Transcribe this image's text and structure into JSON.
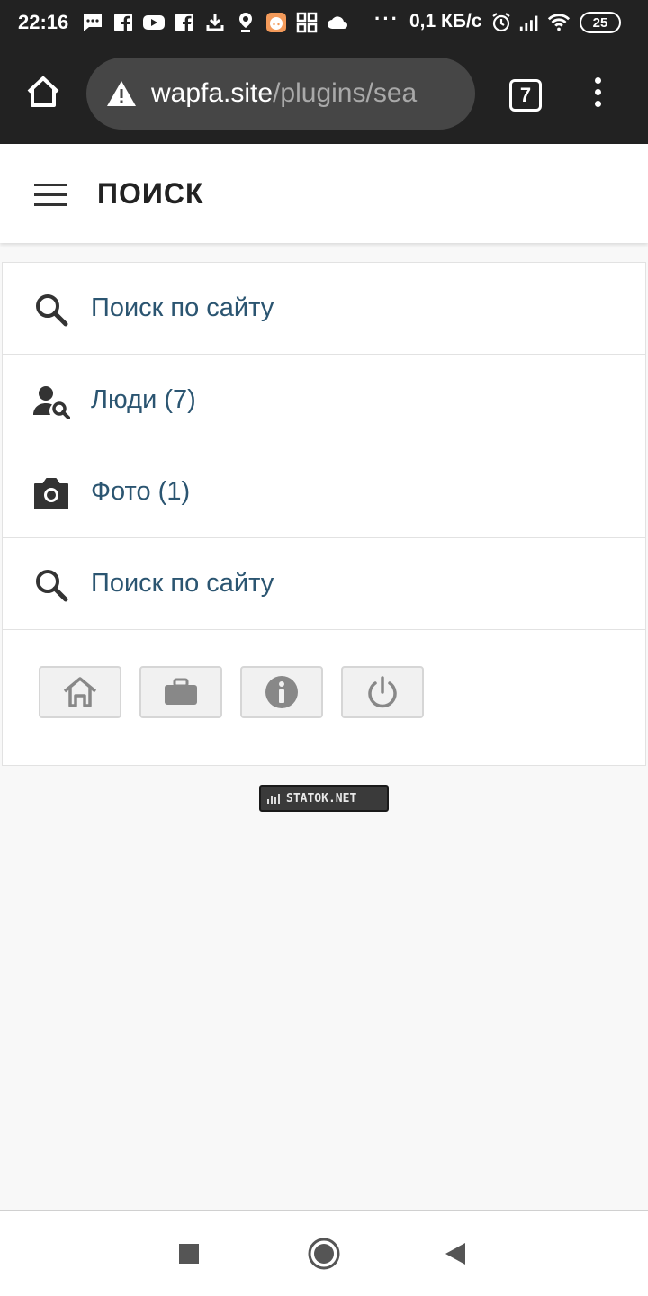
{
  "status_bar": {
    "time": "22:16",
    "dots": "···",
    "speed": "0,1 КБ/с",
    "battery": "25"
  },
  "browser": {
    "url_domain": "wapfa.site",
    "url_path": "/plugins/sea",
    "tab_count": "7"
  },
  "header": {
    "title": "ПОИСК"
  },
  "menu": {
    "items": [
      {
        "label": "Поиск по сайту",
        "icon": "search-icon"
      },
      {
        "label": "Люди (7)",
        "icon": "person-search-icon"
      },
      {
        "label": "Фото (1)",
        "icon": "camera-icon"
      },
      {
        "label": "Поиск по сайту",
        "icon": "search-icon"
      }
    ]
  },
  "toolbar": {
    "buttons": [
      "home-icon",
      "briefcase-icon",
      "info-icon",
      "power-icon"
    ]
  },
  "counter": {
    "label": "STATOK.NET"
  },
  "colors": {
    "link": "#2b5571",
    "chrome_dark": "#222222",
    "url_field": "#464646"
  }
}
